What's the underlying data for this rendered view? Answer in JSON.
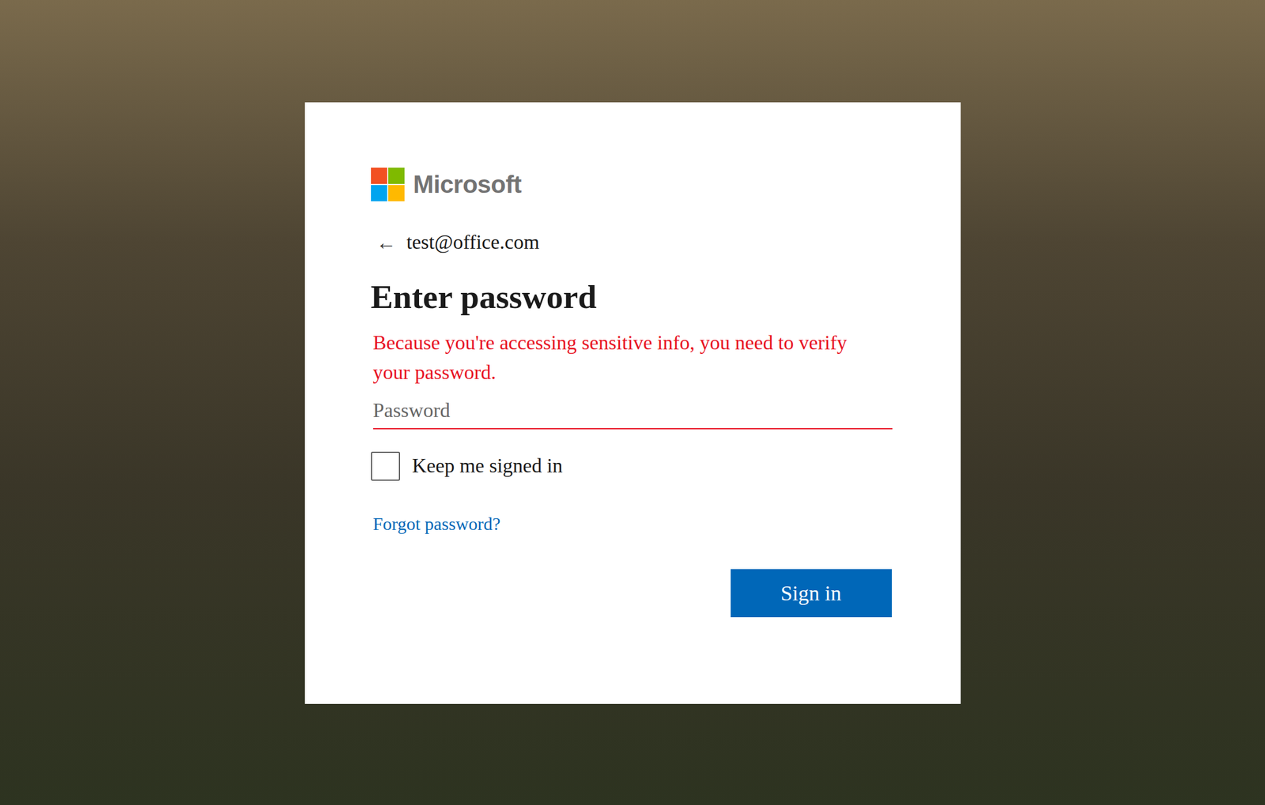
{
  "brand": {
    "name": "Microsoft"
  },
  "account": {
    "back": "←",
    "email": "test@office.com"
  },
  "heading": "Enter password",
  "message": "Because you're accessing sensitive info, you need to verify your password.",
  "password_field": {
    "placeholder": "Password",
    "value": ""
  },
  "keep_signed_in": {
    "label": "Keep me signed in",
    "checked": false
  },
  "forgot_link": "Forgot password?",
  "buttons": [
    "Sign in"
  ]
}
